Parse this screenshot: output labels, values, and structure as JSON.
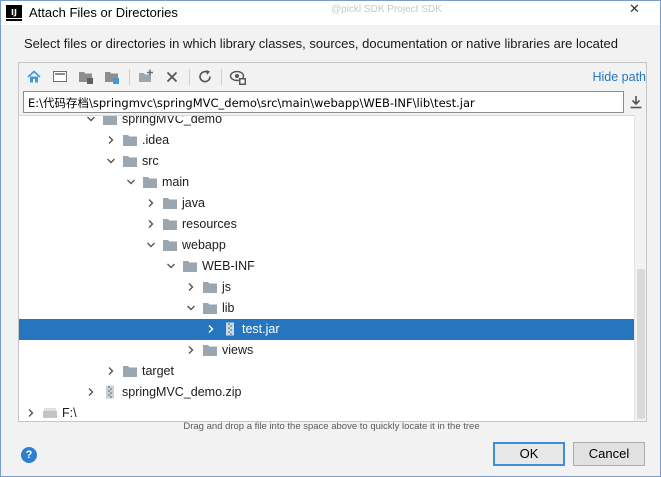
{
  "window": {
    "title": "Attach Files or Directories",
    "app_icon_text": "IJ",
    "background_ghost_text": "@pickl SDK  Project SDK",
    "close_glyph": "✕"
  },
  "instruction": "Select files or directories in which library classes, sources, documentation or native libraries are located",
  "toolbar": {
    "buttons": [
      "home-icon",
      "desktop-icon",
      "project-folder-icon",
      "module-folder-icon",
      "new-folder-icon",
      "delete-icon",
      "refresh-icon",
      "show-hidden-icon"
    ],
    "hide_path_label": "Hide path"
  },
  "path_field": {
    "value": "E:\\代码存档\\springmvc\\springMVC_demo\\src\\main\\webapp\\WEB-INF\\lib\\test.jar"
  },
  "tree": {
    "items": [
      {
        "label": "springMVC_demo",
        "type": "folder",
        "depth": 4,
        "expanded": true,
        "partial": true
      },
      {
        "label": ".idea",
        "type": "folder",
        "depth": 5,
        "expanded": false
      },
      {
        "label": "src",
        "type": "folder",
        "depth": 5,
        "expanded": true
      },
      {
        "label": "main",
        "type": "folder",
        "depth": 6,
        "expanded": true
      },
      {
        "label": "java",
        "type": "folder",
        "depth": 7,
        "expanded": false
      },
      {
        "label": "resources",
        "type": "folder",
        "depth": 7,
        "expanded": false
      },
      {
        "label": "webapp",
        "type": "folder",
        "depth": 7,
        "expanded": true
      },
      {
        "label": "WEB-INF",
        "type": "folder",
        "depth": 8,
        "expanded": true
      },
      {
        "label": "js",
        "type": "folder",
        "depth": 9,
        "expanded": false
      },
      {
        "label": "lib",
        "type": "folder",
        "depth": 9,
        "expanded": true
      },
      {
        "label": "test.jar",
        "type": "jar",
        "depth": 10,
        "expanded": false,
        "selected": true
      },
      {
        "label": "views",
        "type": "folder",
        "depth": 9,
        "expanded": false
      },
      {
        "label": "target",
        "type": "folder",
        "depth": 5,
        "expanded": false
      },
      {
        "label": "springMVC_demo.zip",
        "type": "zip",
        "depth": 4,
        "expanded": false
      },
      {
        "label": "F:\\",
        "type": "drive",
        "depth": 1,
        "expanded": false
      }
    ]
  },
  "hint": "Drag and drop a file into the space above to quickly locate it in the tree",
  "buttons": {
    "help": "?",
    "ok": "OK",
    "cancel": "Cancel"
  },
  "colors": {
    "selection": "#2675bf",
    "link": "#2675bf",
    "folder": "#9aa7b0"
  }
}
